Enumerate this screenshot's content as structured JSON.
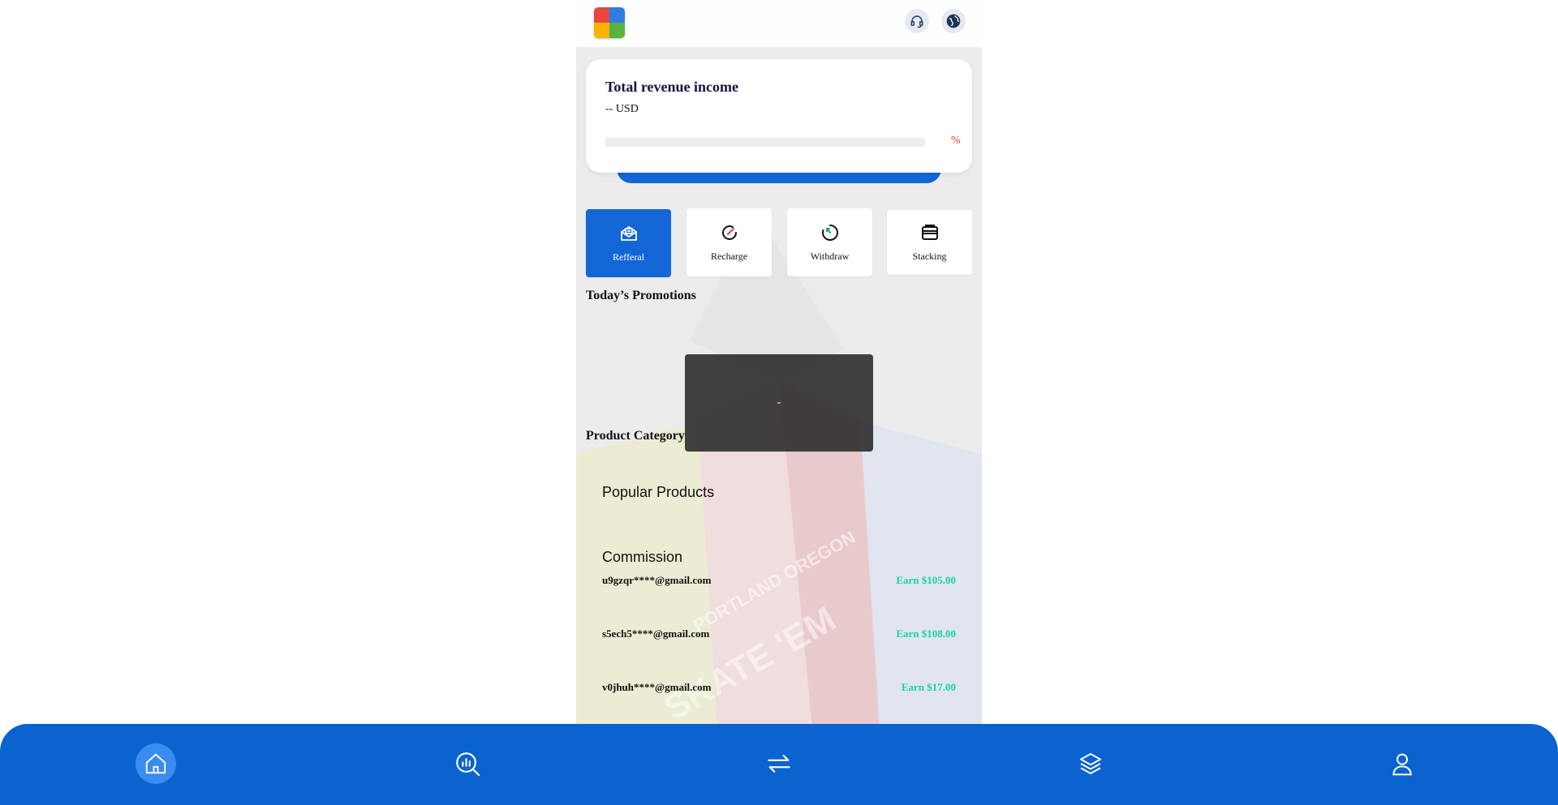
{
  "header": {
    "logo_icon": "app-logo",
    "support_icon": "headset-icon",
    "language_icon": "globe-icon"
  },
  "revenue": {
    "title": "Total revenue income",
    "amount": "-- USD",
    "progress_fraction": 0,
    "percent_label": "%"
  },
  "actions": [
    {
      "label": "Refferal",
      "icon": "mail-open-icon",
      "active": true
    },
    {
      "label": "Recharge",
      "icon": "gauge-icon",
      "active": false
    },
    {
      "label": "Withdraw",
      "icon": "timer-icon",
      "active": false
    },
    {
      "label": "Stacking",
      "icon": "wallet-icon",
      "active": false
    }
  ],
  "sections": {
    "promotions": "Today’s Promotions",
    "product_category": "Product Category"
  },
  "toast": {
    "text": "-"
  },
  "categories": {
    "popular": "Popular Products",
    "commission": "Commission"
  },
  "feed": [
    {
      "email": "u9gzqr****@gmail.com",
      "earn": "Earn $105.00"
    },
    {
      "email": "s5ech5****@gmail.com",
      "earn": "Earn $108.00"
    },
    {
      "email": "v0jhuh****@gmail.com",
      "earn": "Earn $17.00"
    }
  ],
  "nav": [
    {
      "icon": "home-icon",
      "active": true
    },
    {
      "icon": "market-chart-icon",
      "active": false
    },
    {
      "icon": "swap-arrows-icon",
      "active": false
    },
    {
      "icon": "layers-icon",
      "active": false
    },
    {
      "icon": "user-icon",
      "active": false
    }
  ],
  "colors": {
    "primary": "#0a63cf",
    "accent": "#1266d6",
    "earn_text": "#16d3a8",
    "percent": "#e34040"
  }
}
